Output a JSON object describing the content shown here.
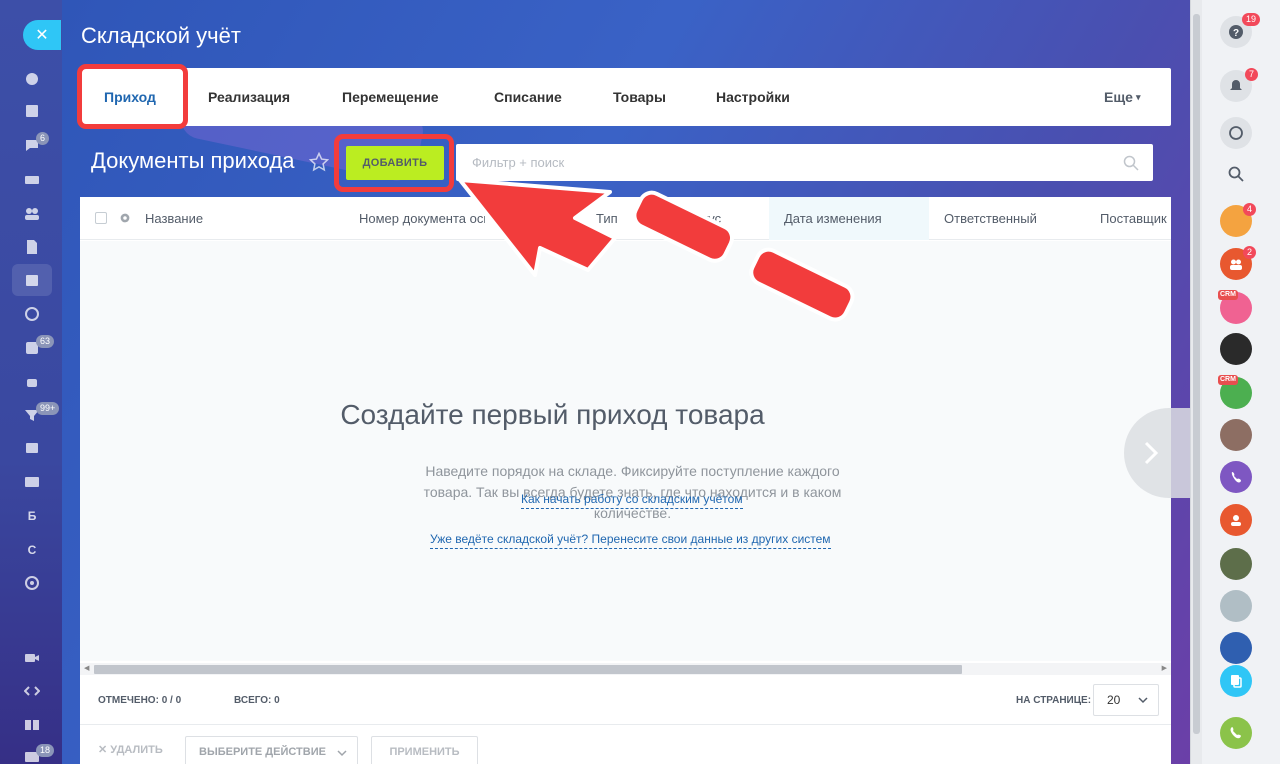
{
  "app": {
    "title": "Складской учёт"
  },
  "tabs": [
    {
      "label": "Приход",
      "active": true
    },
    {
      "label": "Реализация"
    },
    {
      "label": "Перемещение"
    },
    {
      "label": "Списание"
    },
    {
      "label": "Товары"
    },
    {
      "label": "Настройки"
    }
  ],
  "more_label": "Еще",
  "toolbar": {
    "title": "Документы прихода",
    "add_label": "ДОБАВИТЬ",
    "filter_placeholder": "Фильтр + поиск"
  },
  "grid": {
    "columns": [
      "Название",
      "Номер документа основания",
      "Тип",
      "Статус",
      "Дата изменения",
      "Ответственный",
      "Поставщик"
    ],
    "empty": {
      "title": "Создайте первый приход товара",
      "description": "Наведите порядок на складе. Фиксируйте поступление каждого товара. Так вы всегда будете знать, где что находится и в каком количестве.",
      "link1": "Как начать работу со складским учётом",
      "link2": "Уже ведёте складской учёт? Перенесите свои данные из других систем"
    },
    "footer": {
      "marked": "ОТМЕЧЕНО: 0 / 0",
      "total": "ВСЕГО: 0",
      "per_page_label": "НА СТРАНИЦЕ:",
      "per_page_value": "20"
    },
    "actions": {
      "delete": "УДАЛИТЬ",
      "select_placeholder": "ВЫБЕРИТЕ ДЕЙСТВИЕ",
      "apply": "ПРИМЕНИТЬ"
    }
  },
  "left_nav": {
    "badges": [
      "6",
      "63",
      "99+",
      "18"
    ],
    "letters": [
      "Б",
      "С"
    ]
  },
  "right_nav": {
    "badges": [
      "19",
      "7",
      "4",
      "2"
    ],
    "crm_label": "CRM"
  },
  "colors": {
    "accent": "#2067b0",
    "add_button": "#bbed21",
    "highlight": "#f23c3c",
    "close_button": "#2fc6f6"
  }
}
